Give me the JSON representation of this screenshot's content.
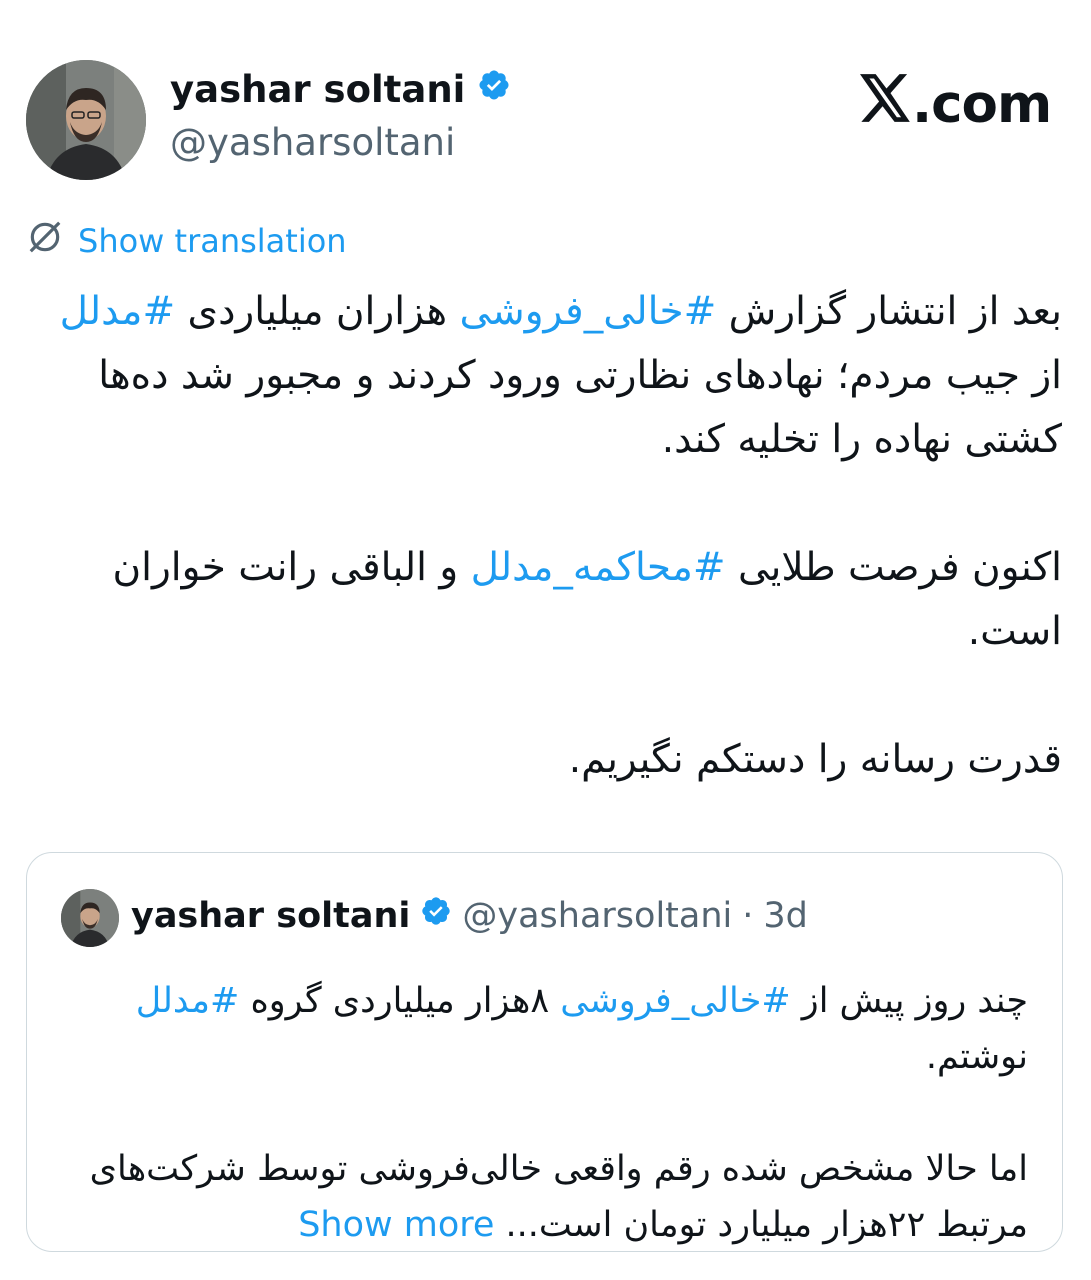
{
  "author": {
    "name": "yashar soltani",
    "handle": "@yasharsoltani"
  },
  "brand": {
    "text": ".com"
  },
  "translation": {
    "label": "Show translation"
  },
  "tweet": {
    "p1": {
      "a": "بعد از انتشار گزارش ",
      "tag1": "#خالی_فروشی",
      "b": " هزاران میلیاردی ",
      "tag2": "#مدلل",
      "c": " از جیب مردم؛ نهادهای نظارتی ورود کردند و مجبور شد ده‌ها کشتی نهاده را تخلیه کند."
    },
    "p2": {
      "a": "اکنون فرصت طلایی ",
      "tag1": "#محاکمه_مدلل",
      "b": " و الباقی رانت خواران است."
    },
    "p3": "قدرت رسانه را دستکم نگیریم."
  },
  "quote": {
    "name": "yashar soltani",
    "handle": "@yasharsoltani",
    "separator": "·",
    "time": "3d",
    "p1": {
      "a": "چند روز پیش از ",
      "tag1": "#خالی_فروشی",
      "b": " ۸هزار میلیاردی گروه ",
      "tag2": "#مدلل",
      "c": " نوشتم."
    },
    "p2": {
      "a": "اما حالا مشخص شده رقم واقعی خالی‌فروشی توسط شرکت‌های مرتبط ۲۲هزار میلیارد تومان است... ",
      "more": "Show more"
    }
  },
  "colors": {
    "link": "#1d9bf0",
    "verified": "#1d9bf0",
    "secondary_text": "#536471",
    "border": "#cfd9de"
  },
  "icons": [
    "verified-badge-icon",
    "translate-icon",
    "x-logo-icon"
  ]
}
